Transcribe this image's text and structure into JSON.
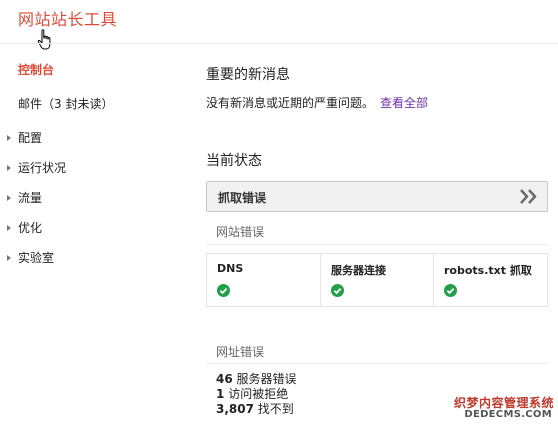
{
  "app_title": "网站站长工具",
  "sidebar": {
    "items": [
      {
        "label": "控制台",
        "state": "active"
      },
      {
        "label": "邮件（3 封未读）",
        "state": "plain"
      },
      {
        "label": "配置",
        "state": "collapsed"
      },
      {
        "label": "运行状况",
        "state": "collapsed"
      },
      {
        "label": "流量",
        "state": "collapsed"
      },
      {
        "label": "优化",
        "state": "collapsed"
      },
      {
        "label": "实验室",
        "state": "collapsed"
      }
    ]
  },
  "news": {
    "title": "重要的新消息",
    "text": "没有新消息或近期的严重问题。",
    "link": "查看全部"
  },
  "status": {
    "title": "当前状态",
    "crawl_errors_label": "抓取错误",
    "site_errors": {
      "title": "网站错误",
      "columns": [
        {
          "label": "DNS",
          "status": "ok"
        },
        {
          "label": "服务器连接",
          "status": "ok"
        },
        {
          "label": "robots.txt 抓取",
          "status": "ok"
        }
      ]
    },
    "url_errors": {
      "title": "网址错误",
      "rows": [
        {
          "count": "46",
          "label": "服务器错误"
        },
        {
          "count": "1",
          "label": "访问被拒绝"
        },
        {
          "count": "3,807",
          "label": "找不到"
        }
      ]
    }
  },
  "watermark": {
    "cn": "织梦内容管理系统",
    "en": "DEDECMS.COM"
  },
  "colors": {
    "accent": "#dd4b39",
    "link": "#7031a5",
    "ok_green": "#21a047"
  }
}
